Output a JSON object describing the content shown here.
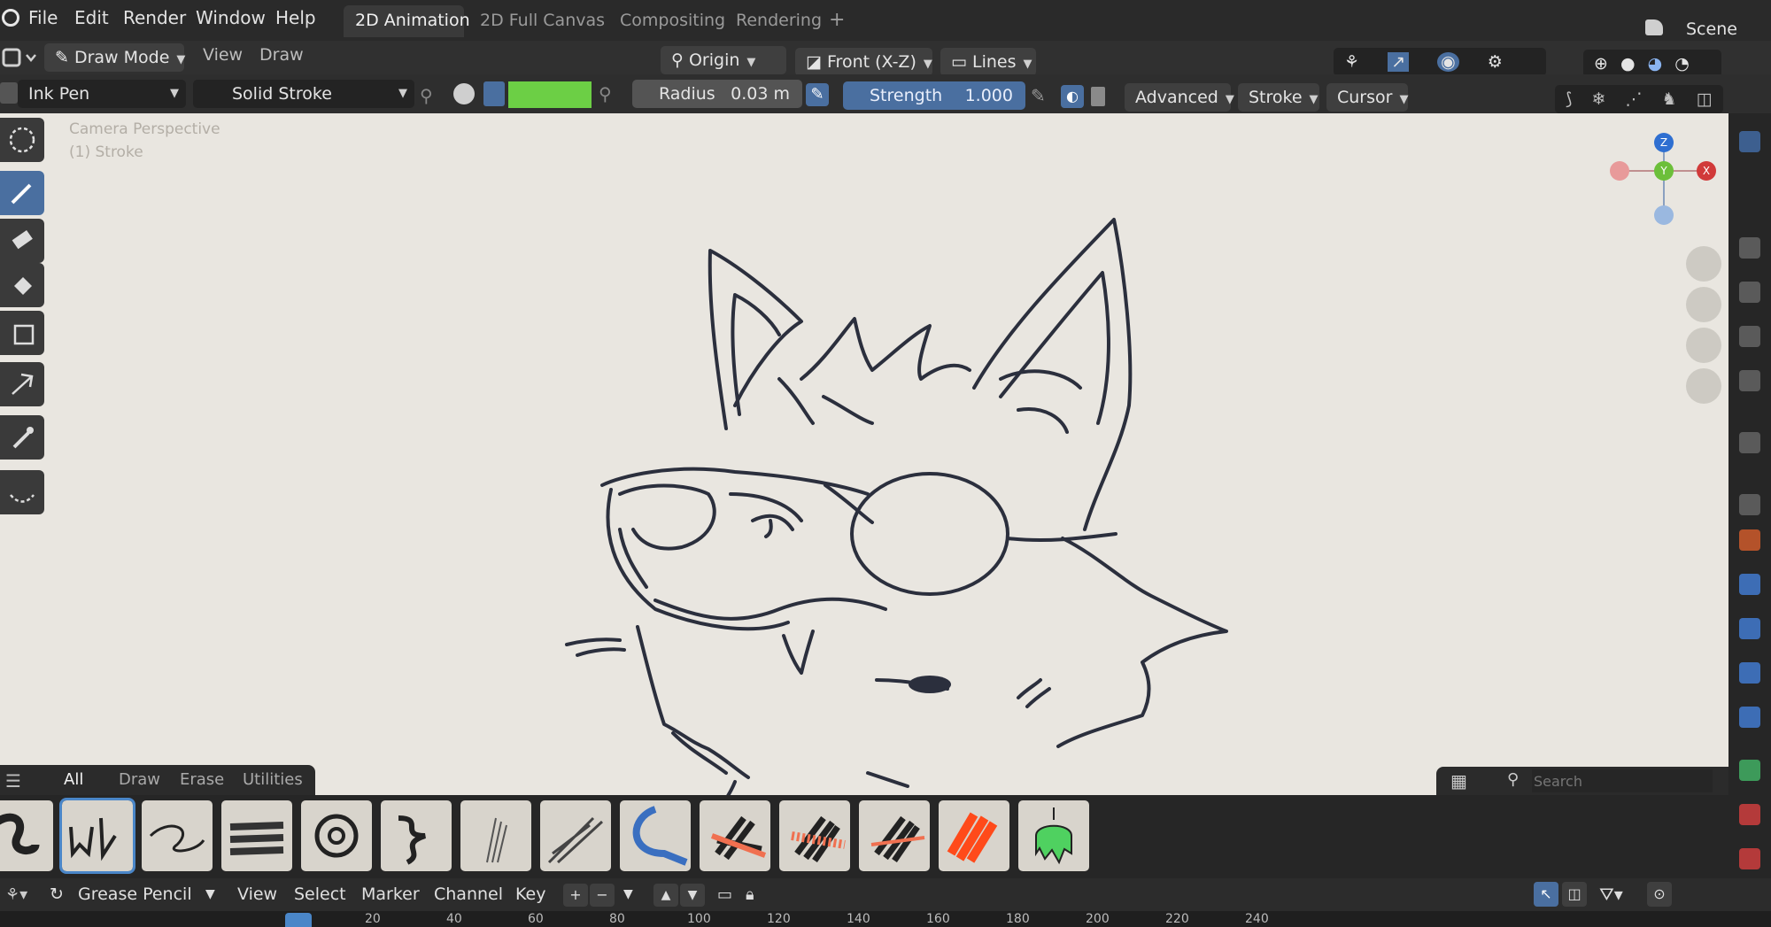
{
  "menu": {
    "items": [
      "File",
      "Edit",
      "Render",
      "Window",
      "Help"
    ],
    "workspaces": [
      {
        "label": "2D Animation",
        "active": true
      },
      {
        "label": "2D Full Canvas",
        "active": false
      },
      {
        "label": "Compositing",
        "active": false
      },
      {
        "label": "Rendering",
        "active": false
      }
    ],
    "add_tab": "+",
    "scene_label": "Scene"
  },
  "header": {
    "mode": "Draw Mode",
    "view": "View",
    "draw": "Draw",
    "origin": "Origin",
    "projection": "Front (X-Z)",
    "placement": "Lines"
  },
  "tool_settings": {
    "brush": "Ink Pen",
    "stroke_material": "Solid Stroke",
    "color": "#6ccf45",
    "radius_label": "Radius",
    "radius_value": "0.03 m",
    "strength_label": "Strength",
    "strength_value": "1.000",
    "advanced": "Advanced",
    "stroke": "Stroke",
    "cursor": "Cursor"
  },
  "viewport": {
    "info_line1": "Camera Perspective",
    "info_line2": "(1) Stroke",
    "gizmo_axes": [
      "Z",
      "Y",
      "X"
    ]
  },
  "asset_shelf": {
    "tabs": [
      {
        "label": "All",
        "active": true
      },
      {
        "label": "Draw",
        "active": false
      },
      {
        "label": "Erase",
        "active": false
      },
      {
        "label": "Utilities",
        "active": false
      }
    ],
    "search_placeholder": "Search"
  },
  "timeline": {
    "editor": "Grease Pencil",
    "menus": [
      "View",
      "Select",
      "Marker",
      "Channel",
      "Key"
    ],
    "ticks": [
      "20",
      "40",
      "60",
      "80",
      "100",
      "120",
      "140",
      "160",
      "180",
      "200",
      "220",
      "240"
    ]
  },
  "colors": {
    "viewport_bg": "#e9e6e0",
    "accent": "#4a6fa0",
    "stroke_line": "#2b2f3d"
  }
}
